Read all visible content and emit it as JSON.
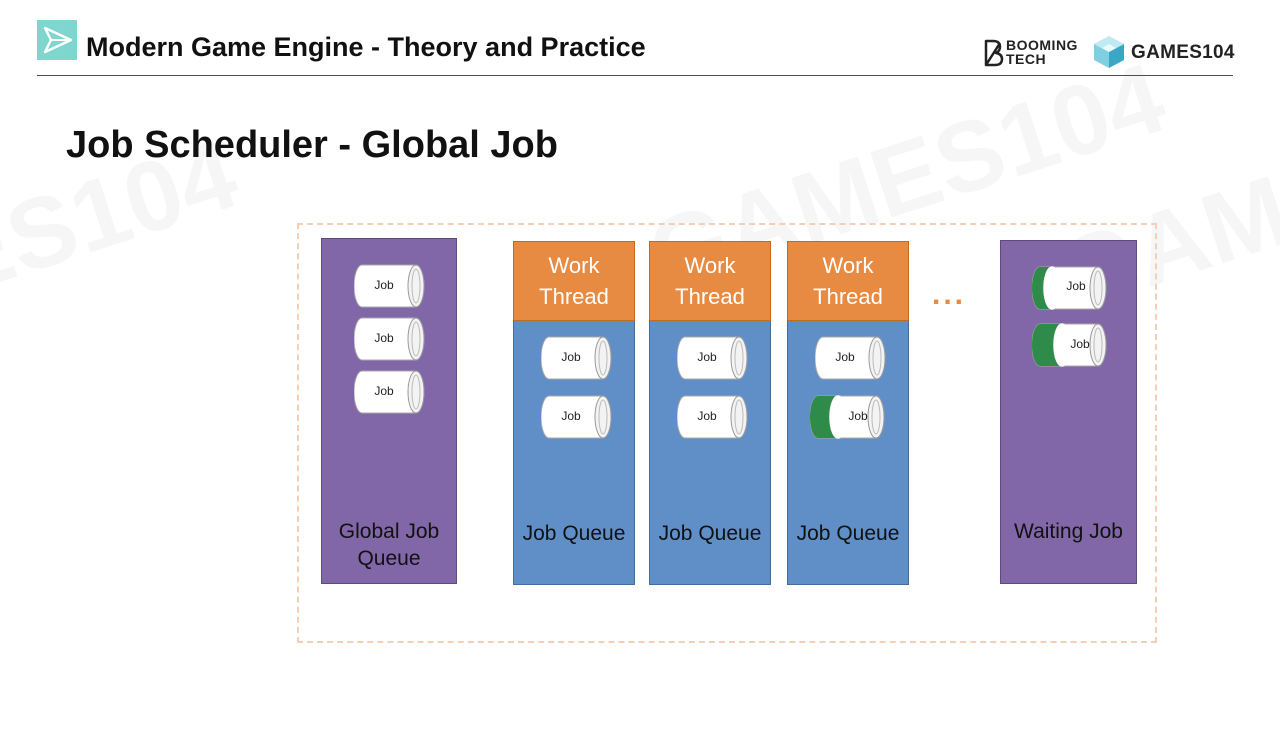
{
  "header": {
    "course_title": "Modern Game Engine - Theory and Practice",
    "booming_tech_line1": "BOOMING",
    "booming_tech_line2": "TECH",
    "games_logo_text": "GAMES104"
  },
  "slide": {
    "title": "Job Scheduler - Global Job"
  },
  "diagram": {
    "global_queue": {
      "label_line1": "Global Job",
      "label_line2": "Queue",
      "jobs": [
        "Job",
        "Job",
        "Job"
      ]
    },
    "work_threads": [
      {
        "header_line1": "Work",
        "header_line2": "Thread",
        "queue_label": "Job Queue",
        "jobs": [
          "Job",
          "Job"
        ]
      },
      {
        "header_line1": "Work",
        "header_line2": "Thread",
        "queue_label": "Job Queue",
        "jobs": [
          "Job",
          "Job"
        ]
      },
      {
        "header_line1": "Work",
        "header_line2": "Thread",
        "queue_label": "Job Queue",
        "jobs": [
          "Job",
          "Job"
        ]
      }
    ],
    "ellipsis": "...",
    "waiting": {
      "label": "Waiting Job",
      "jobs": [
        "Job",
        "Job"
      ]
    },
    "colors": {
      "purple": "#8166a8",
      "blue": "#5f8fc6",
      "orange": "#e88b42",
      "waiting_job_green": "#2e8b4a"
    }
  }
}
